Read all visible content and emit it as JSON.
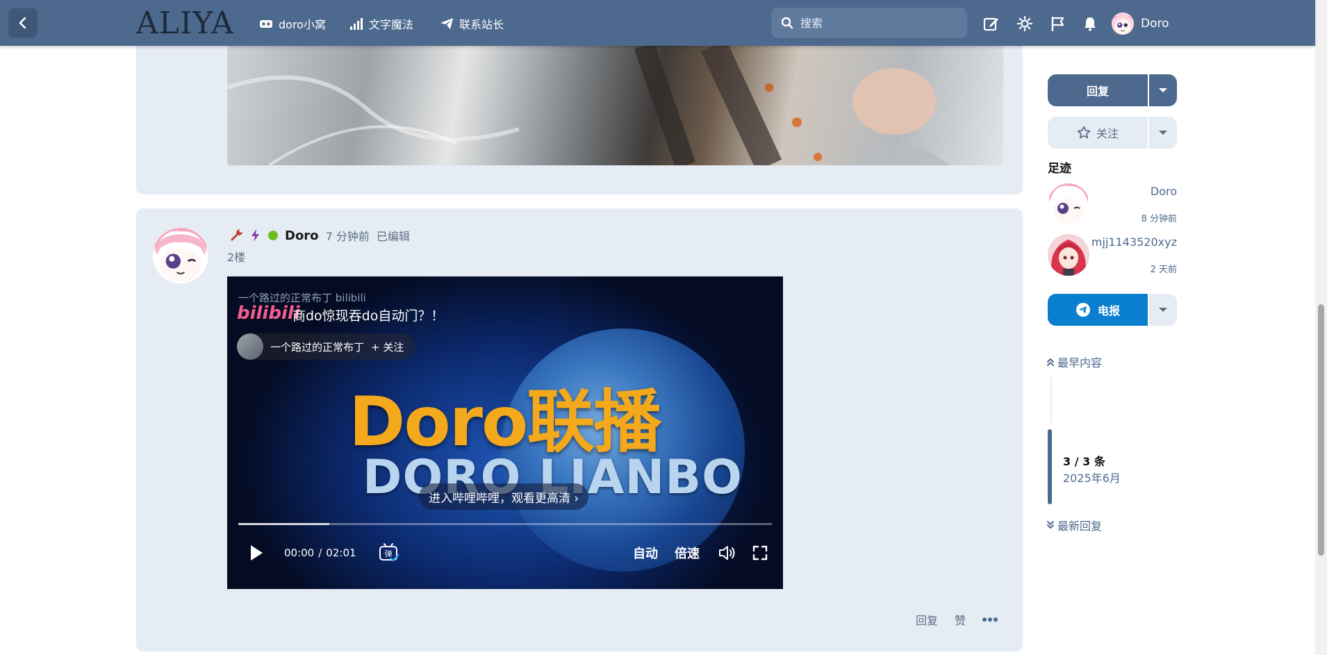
{
  "header": {
    "logo": "ALIYA",
    "nav": [
      {
        "label": "doro小窝",
        "icon": "vr-headset-icon"
      },
      {
        "label": "文字魔法",
        "icon": "signal-bars-icon"
      },
      {
        "label": "联系站长",
        "icon": "paper-plane-icon"
      }
    ],
    "search_placeholder": "搜索",
    "user_name": "Doro"
  },
  "post": {
    "author": "Doro",
    "time": "7 分钟前",
    "edited": "已编辑",
    "floor": "2楼",
    "video": {
      "watermark": "一个路过的正常布丁 bilibili",
      "brand": "bilibili",
      "title": "商do惊现吞do自动门？！",
      "uploader": "一个路过的正常布丁",
      "follow": "+ 关注",
      "big_title": "Doro联播",
      "sub_title": "DORO LIANBO",
      "enter_text": "进入哔哩哔哩，观看更高清 ›",
      "current_time": "00:00",
      "separator": "/",
      "duration": "02:01",
      "danmaku": "弹",
      "quality": "自动",
      "speed": "倍速",
      "buffered_fraction": 0.17
    },
    "actions": {
      "reply": "回复",
      "like": "赞"
    }
  },
  "sidebar": {
    "reply": "回复",
    "follow": "关注",
    "footprint_title": "足迹",
    "footprints": [
      {
        "name": "Doro",
        "time": "8 分钟前"
      },
      {
        "name": "mjj1143520xyz",
        "time": "2 天前"
      }
    ],
    "telegram": "电报",
    "timeline": {
      "earliest": "最早内容",
      "count": "3 / 3 条",
      "date": "2025年6月",
      "latest": "最新回复"
    }
  },
  "colors": {
    "header": "#4d698e",
    "card": "#e6ecf3",
    "telegram": "#0b7fcf",
    "online": "#6bbf1a",
    "accent_text": "#4d698e"
  }
}
